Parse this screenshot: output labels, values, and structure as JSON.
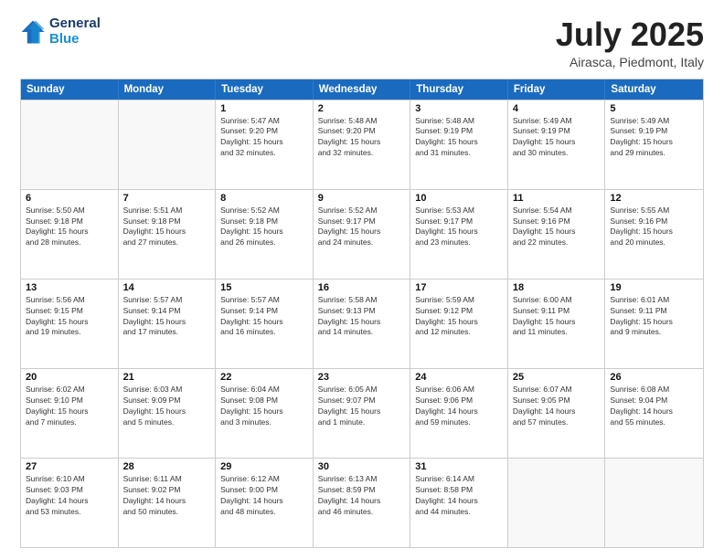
{
  "header": {
    "logo": {
      "line1": "General",
      "line2": "Blue"
    },
    "title": "July 2025",
    "location": "Airasca, Piedmont, Italy"
  },
  "days_of_week": [
    "Sunday",
    "Monday",
    "Tuesday",
    "Wednesday",
    "Thursday",
    "Friday",
    "Saturday"
  ],
  "weeks": [
    [
      {
        "day": null,
        "detail": null
      },
      {
        "day": null,
        "detail": null
      },
      {
        "day": "1",
        "detail": "Sunrise: 5:47 AM\nSunset: 9:20 PM\nDaylight: 15 hours\nand 32 minutes."
      },
      {
        "day": "2",
        "detail": "Sunrise: 5:48 AM\nSunset: 9:20 PM\nDaylight: 15 hours\nand 32 minutes."
      },
      {
        "day": "3",
        "detail": "Sunrise: 5:48 AM\nSunset: 9:19 PM\nDaylight: 15 hours\nand 31 minutes."
      },
      {
        "day": "4",
        "detail": "Sunrise: 5:49 AM\nSunset: 9:19 PM\nDaylight: 15 hours\nand 30 minutes."
      },
      {
        "day": "5",
        "detail": "Sunrise: 5:49 AM\nSunset: 9:19 PM\nDaylight: 15 hours\nand 29 minutes."
      }
    ],
    [
      {
        "day": "6",
        "detail": "Sunrise: 5:50 AM\nSunset: 9:18 PM\nDaylight: 15 hours\nand 28 minutes."
      },
      {
        "day": "7",
        "detail": "Sunrise: 5:51 AM\nSunset: 9:18 PM\nDaylight: 15 hours\nand 27 minutes."
      },
      {
        "day": "8",
        "detail": "Sunrise: 5:52 AM\nSunset: 9:18 PM\nDaylight: 15 hours\nand 26 minutes."
      },
      {
        "day": "9",
        "detail": "Sunrise: 5:52 AM\nSunset: 9:17 PM\nDaylight: 15 hours\nand 24 minutes."
      },
      {
        "day": "10",
        "detail": "Sunrise: 5:53 AM\nSunset: 9:17 PM\nDaylight: 15 hours\nand 23 minutes."
      },
      {
        "day": "11",
        "detail": "Sunrise: 5:54 AM\nSunset: 9:16 PM\nDaylight: 15 hours\nand 22 minutes."
      },
      {
        "day": "12",
        "detail": "Sunrise: 5:55 AM\nSunset: 9:16 PM\nDaylight: 15 hours\nand 20 minutes."
      }
    ],
    [
      {
        "day": "13",
        "detail": "Sunrise: 5:56 AM\nSunset: 9:15 PM\nDaylight: 15 hours\nand 19 minutes."
      },
      {
        "day": "14",
        "detail": "Sunrise: 5:57 AM\nSunset: 9:14 PM\nDaylight: 15 hours\nand 17 minutes."
      },
      {
        "day": "15",
        "detail": "Sunrise: 5:57 AM\nSunset: 9:14 PM\nDaylight: 15 hours\nand 16 minutes."
      },
      {
        "day": "16",
        "detail": "Sunrise: 5:58 AM\nSunset: 9:13 PM\nDaylight: 15 hours\nand 14 minutes."
      },
      {
        "day": "17",
        "detail": "Sunrise: 5:59 AM\nSunset: 9:12 PM\nDaylight: 15 hours\nand 12 minutes."
      },
      {
        "day": "18",
        "detail": "Sunrise: 6:00 AM\nSunset: 9:11 PM\nDaylight: 15 hours\nand 11 minutes."
      },
      {
        "day": "19",
        "detail": "Sunrise: 6:01 AM\nSunset: 9:11 PM\nDaylight: 15 hours\nand 9 minutes."
      }
    ],
    [
      {
        "day": "20",
        "detail": "Sunrise: 6:02 AM\nSunset: 9:10 PM\nDaylight: 15 hours\nand 7 minutes."
      },
      {
        "day": "21",
        "detail": "Sunrise: 6:03 AM\nSunset: 9:09 PM\nDaylight: 15 hours\nand 5 minutes."
      },
      {
        "day": "22",
        "detail": "Sunrise: 6:04 AM\nSunset: 9:08 PM\nDaylight: 15 hours\nand 3 minutes."
      },
      {
        "day": "23",
        "detail": "Sunrise: 6:05 AM\nSunset: 9:07 PM\nDaylight: 15 hours\nand 1 minute."
      },
      {
        "day": "24",
        "detail": "Sunrise: 6:06 AM\nSunset: 9:06 PM\nDaylight: 14 hours\nand 59 minutes."
      },
      {
        "day": "25",
        "detail": "Sunrise: 6:07 AM\nSunset: 9:05 PM\nDaylight: 14 hours\nand 57 minutes."
      },
      {
        "day": "26",
        "detail": "Sunrise: 6:08 AM\nSunset: 9:04 PM\nDaylight: 14 hours\nand 55 minutes."
      }
    ],
    [
      {
        "day": "27",
        "detail": "Sunrise: 6:10 AM\nSunset: 9:03 PM\nDaylight: 14 hours\nand 53 minutes."
      },
      {
        "day": "28",
        "detail": "Sunrise: 6:11 AM\nSunset: 9:02 PM\nDaylight: 14 hours\nand 50 minutes."
      },
      {
        "day": "29",
        "detail": "Sunrise: 6:12 AM\nSunset: 9:00 PM\nDaylight: 14 hours\nand 48 minutes."
      },
      {
        "day": "30",
        "detail": "Sunrise: 6:13 AM\nSunset: 8:59 PM\nDaylight: 14 hours\nand 46 minutes."
      },
      {
        "day": "31",
        "detail": "Sunrise: 6:14 AM\nSunset: 8:58 PM\nDaylight: 14 hours\nand 44 minutes."
      },
      {
        "day": null,
        "detail": null
      },
      {
        "day": null,
        "detail": null
      }
    ]
  ]
}
